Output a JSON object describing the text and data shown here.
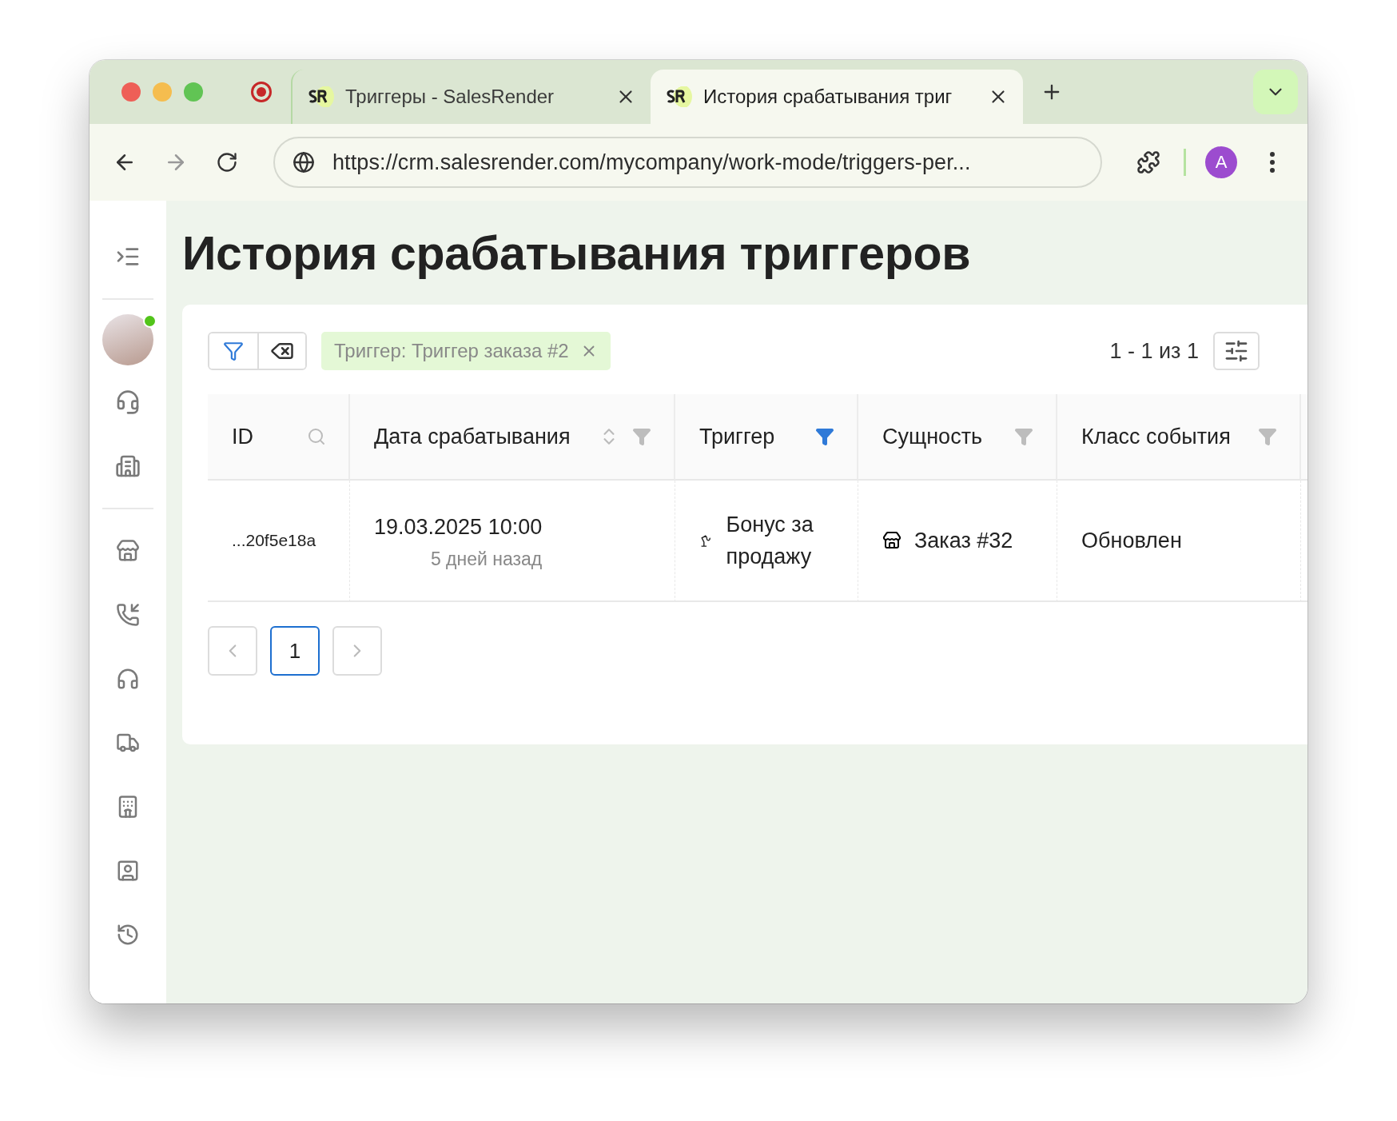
{
  "browser": {
    "tabs": [
      {
        "title": "Триггеры - SalesRender",
        "selected": false
      },
      {
        "title": "История срабатывания триг",
        "selected": true
      }
    ],
    "url": "https://crm.salesrender.com/mycompany/work-mode/triggers-per...",
    "profile": "A"
  },
  "sidebar": {
    "user": {
      "online": true
    }
  },
  "page": {
    "title": "История срабатывания триггеров",
    "filter_chip": "Триггер: Триггер заказа #2",
    "range": "1 - 1 из 1",
    "columns": [
      {
        "label": "ID",
        "kind": "search"
      },
      {
        "label": "Дата срабатывания",
        "kind": "sort_filter",
        "filter_active": false
      },
      {
        "label": "Триггер",
        "kind": "filter",
        "filter_active": true
      },
      {
        "label": "Сущность",
        "kind": "filter",
        "filter_active": false
      },
      {
        "label": "Класс события",
        "kind": "filter",
        "filter_active": false
      }
    ],
    "rows": [
      {
        "id": "...20f5e18a",
        "date": "19.03.2025 10:00",
        "relative": "5 дней назад",
        "trigger": "Бонус за продажу",
        "entity": "Заказ #32",
        "event_class": "Обновлен"
      }
    ],
    "pagination": {
      "pages": [
        {
          "label": "1",
          "selected": true
        }
      ]
    }
  }
}
